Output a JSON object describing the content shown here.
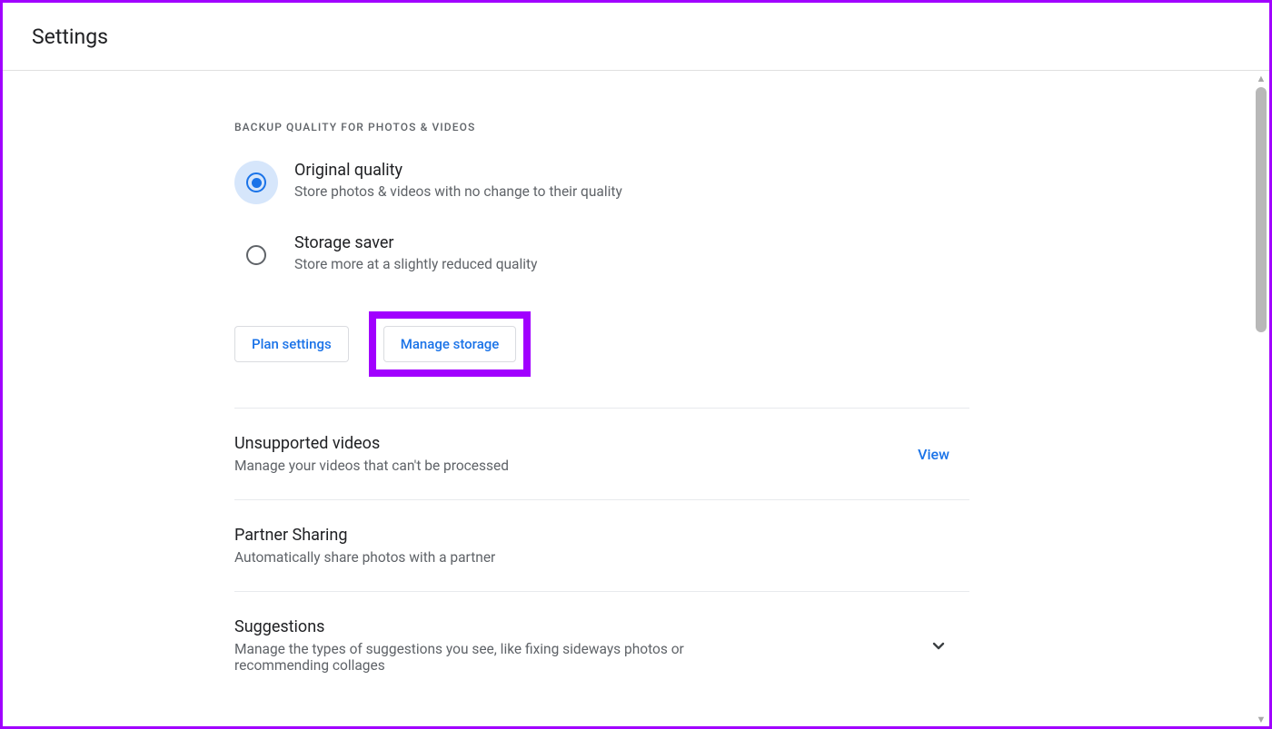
{
  "header": {
    "title": "Settings"
  },
  "backup": {
    "section_label": "BACKUP QUALITY FOR PHOTOS & VIDEOS",
    "options": [
      {
        "title": "Original quality",
        "desc": "Store photos & videos with no change to their quality"
      },
      {
        "title": "Storage saver",
        "desc": "Store more at a slightly reduced quality"
      }
    ],
    "buttons": {
      "plan": "Plan settings",
      "manage": "Manage storage"
    }
  },
  "rows": {
    "unsupported": {
      "title": "Unsupported videos",
      "desc": "Manage your videos that can't be processed",
      "action": "View"
    },
    "partner": {
      "title": "Partner Sharing",
      "desc": "Automatically share photos with a partner"
    },
    "suggestions": {
      "title": "Suggestions",
      "desc": "Manage the types of suggestions you see, like fixing sideways photos or recommending collages"
    }
  }
}
